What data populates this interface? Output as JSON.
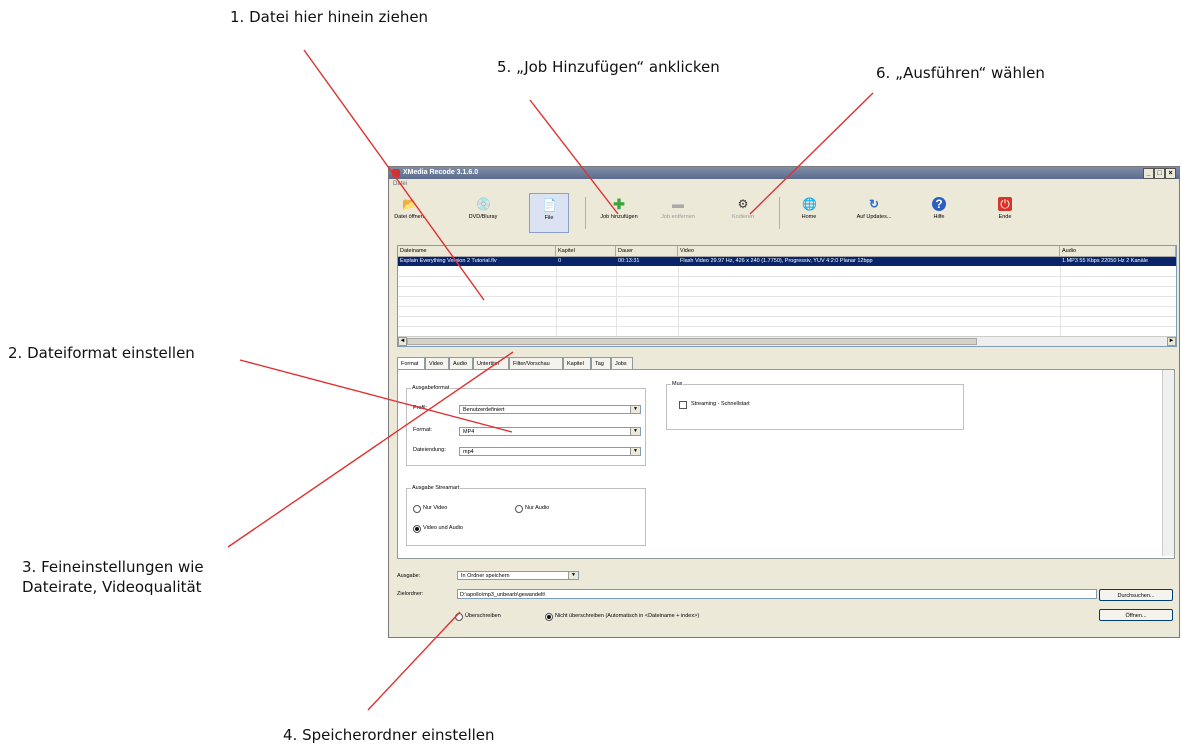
{
  "annotations": {
    "step1": "1. Datei hier hinein ziehen",
    "step2": "2. Dateiformat einstellen",
    "step3_line1": "3. Feineinstellungen wie",
    "step3_line2": "Dateirate, Videoqualität",
    "step4": "4. Speicherordner einstellen",
    "step5": "5. „Job Hinzufügen“ anklicken",
    "step6": "6. „Ausführen“ wählen",
    "arrow_color": "#e03030"
  },
  "window": {
    "title": "XMedia Recode 3.1.6.0",
    "minimize": "_",
    "maximize": "□",
    "close": "×",
    "menu": "Datei"
  },
  "toolbar": {
    "items": [
      {
        "label": "Datei öffnen",
        "icon": "📂"
      },
      {
        "label": "DVD/Bluray",
        "icon": "💿"
      },
      {
        "label": "File",
        "icon": "📄"
      },
      {
        "label": "Job hinzufügen",
        "icon": "✚"
      },
      {
        "label": "Job entfernen",
        "icon": "▬"
      },
      {
        "label": "Kodieren",
        "icon": "⚙"
      },
      {
        "label": "Home",
        "icon": "🌐"
      },
      {
        "label": "Auf Updates...",
        "icon": "↻"
      },
      {
        "label": "Hilfe",
        "icon": "?"
      },
      {
        "label": "Ende",
        "icon": "⏻"
      }
    ]
  },
  "filelist": {
    "headers": [
      "Dateiname",
      "Kapitel",
      "Dauer",
      "Video",
      "Audio"
    ],
    "rows": [
      {
        "dateiname": "Explain Everything Version 2 Tutorial.flv",
        "kapitel": "0",
        "dauer": "00:13:31",
        "video": "Flash Video 29.97 Hz, 426 x 240 (1.7750), Progressiv, YUV 4:2:0 Planar 12bpp",
        "audio": "1.MP3 55 Kbps 22050 Hz 2 Kanäle"
      }
    ],
    "scroll_left": "◄",
    "scroll_right": "►"
  },
  "tabs": [
    "Format",
    "Video",
    "Audio",
    "Untertitel",
    "Filter/Vorschau",
    "Kapitel",
    "Tag",
    "Jobs"
  ],
  "format_panel": {
    "ausgabeformat_title": "Ausgabeformat",
    "profil_label": "Profil:",
    "profil_value": "Benutzerdefiniert",
    "format_label": "Format:",
    "format_value": "MP4",
    "endung_label": "Dateiendung:",
    "endung_value": "mp4",
    "mux_title": "Mux",
    "streaming_label": "Streaming - Schnellstart",
    "stream_title": "Ausgabe Streamart",
    "nur_video": "Nur Video",
    "nur_audio": "Nur Audio",
    "video_audio": "Video und Audio",
    "combo_arrow": "▼"
  },
  "bottom": {
    "ausgabe_label": "Ausgabe:",
    "ausgabe_value": "In Ordner speichern",
    "ziel_label": "Zielordner:",
    "ziel_value": "D:\\apollo\\mp3_unbearb\\gewandelt\\",
    "durchsuchen": "Durchsuchen...",
    "oeffnen": "Öffnen...",
    "ueberschreiben": "Überschreiben",
    "nicht_ueberschreiben": "Nicht überschreiben (Automatisch in <Dateiname + index>)"
  }
}
